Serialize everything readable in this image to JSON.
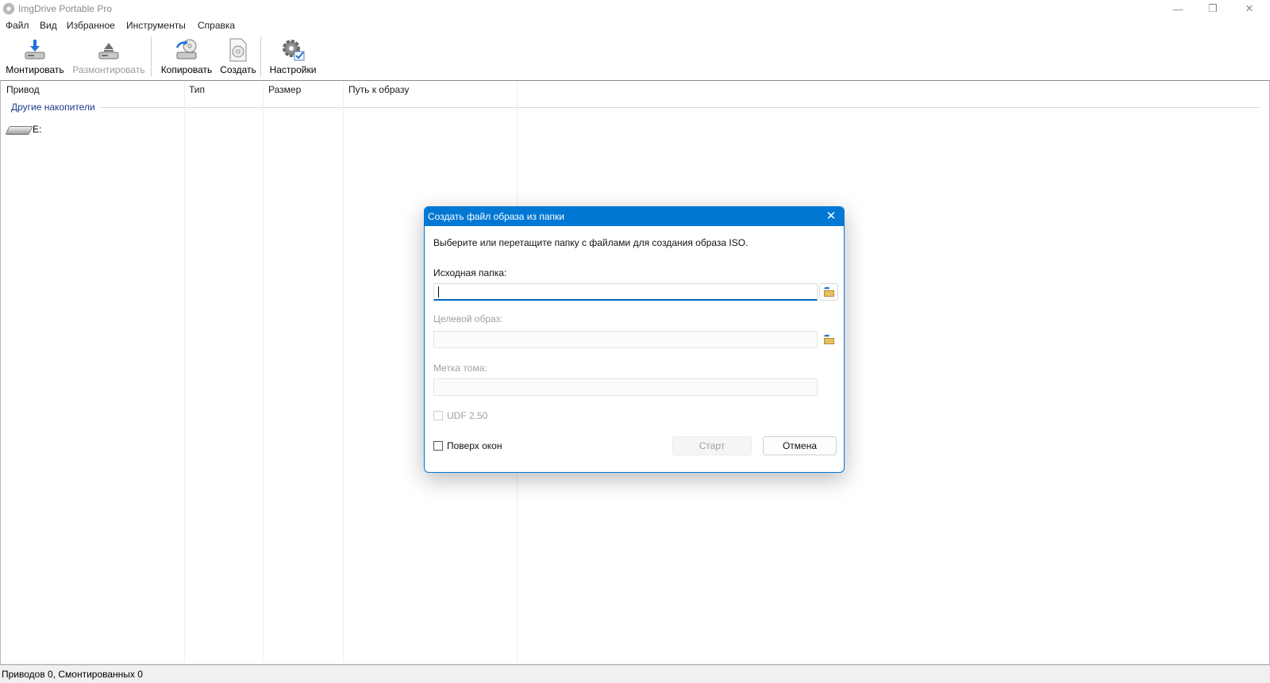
{
  "window": {
    "title": "ImgDrive Portable Pro",
    "controls": {
      "minimize": "—",
      "restore": "❐",
      "close": "✕"
    }
  },
  "menu": [
    "Файл",
    "Вид",
    "Избранное",
    "Инструменты",
    "Справка"
  ],
  "toolbar": {
    "mount": "Монтировать",
    "unmount": "Размонтировать",
    "copy": "Копировать",
    "create": "Создать",
    "settings": "Настройки"
  },
  "list": {
    "columns": [
      "Привод",
      "Тип",
      "Размер",
      "Путь к образу"
    ],
    "group": "Другие накопители",
    "drives": [
      {
        "name": "E:"
      }
    ]
  },
  "status": "Приводов 0, Смонтированных 0",
  "dialog": {
    "title": "Создать файл образа из папки",
    "instructions": "Выберите или перетащите папку с файлами для создания образа ISO.",
    "source_label": "Исходная папка:",
    "source_value": "",
    "target_label": "Целевой образ:",
    "target_value": "",
    "volume_label": "Метка тома:",
    "volume_value": "",
    "udf_label": "UDF 2.50",
    "udf_checked": false,
    "on_top_label": "Поверх окон",
    "on_top_checked": false,
    "start": "Старт",
    "cancel": "Отмена",
    "close_glyph": "✕"
  }
}
